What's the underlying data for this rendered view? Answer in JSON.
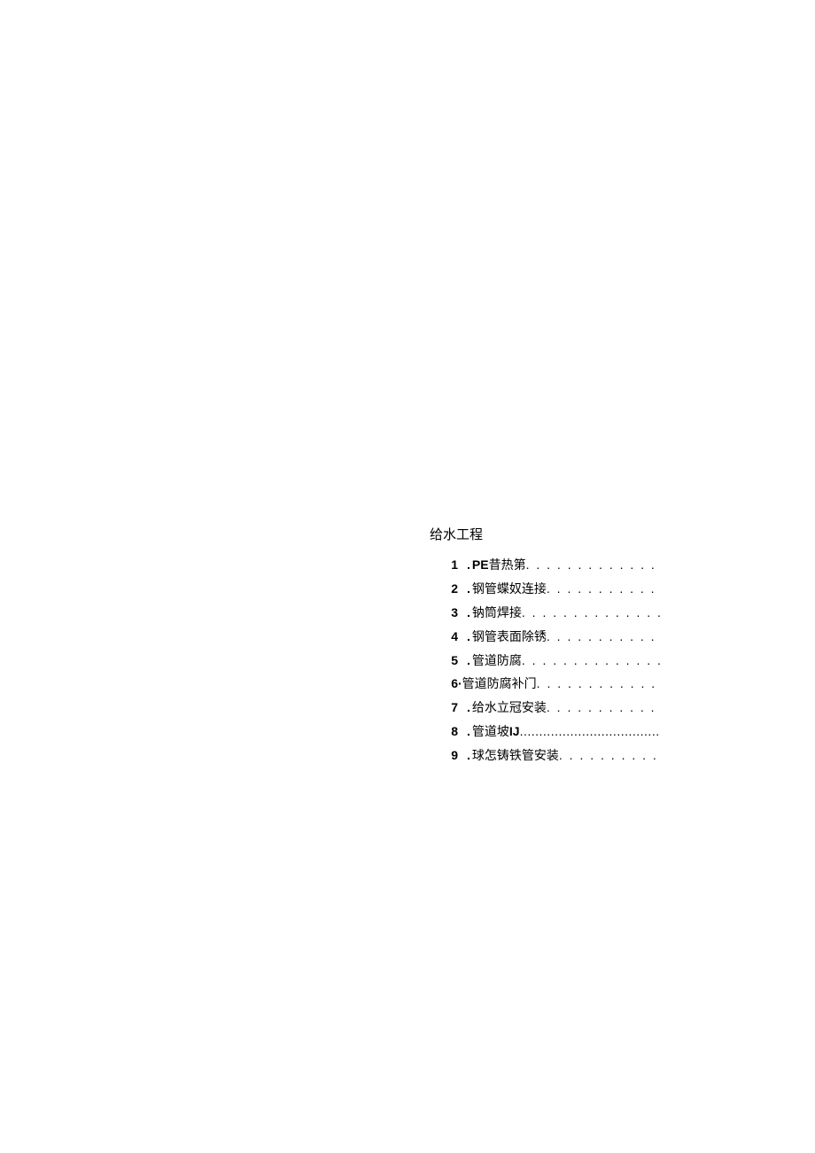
{
  "section": {
    "title": "给水工程"
  },
  "toc": {
    "items": [
      {
        "num": "1",
        "sep": ".",
        "prefix": "PE",
        "text": "昔热第",
        "dots": ". . . . . . . . . . . . . . . . . . . ."
      },
      {
        "num": "2",
        "sep": ".",
        "prefix": "",
        "text": "钢管蝶奴连接",
        "dots": ". . . . . . . . . . . . . . . ."
      },
      {
        "num": "3",
        "sep": ".",
        "prefix": "",
        "text": " 钠筒焊接 ",
        "dots": ". . . . . . . . . . . . . . . . . . . ."
      },
      {
        "num": "4",
        "sep": ".",
        "prefix": "",
        "text": " 钢管表面除锈 ",
        "dots": ". . . . . . . . . . . . . . ."
      },
      {
        "num": "5",
        "sep": ".",
        "prefix": "",
        "text": " 管道防腐 ",
        "dots": ". . . . . . . . . . . . . . . . . . . ."
      },
      {
        "num": "6",
        "sep": "·",
        "prefix": "",
        "text": "管道防腐补门 ",
        "dots": ". . . . . . . . . . . . . . . . ."
      },
      {
        "num": "7",
        "sep": ".",
        "prefix": "",
        "text": "给水立冠安装 ",
        "dots": ". . . . . . . . . . . . . . ."
      },
      {
        "num": "8",
        "sep": ".",
        "prefix": "",
        "text": "管道坡",
        "suffix": "IJ ",
        "dots": "......................................"
      },
      {
        "num": "9",
        "sep": ".",
        "prefix": "",
        "text": " 球怎铸铁管安装 ",
        "dots": ". . . . . . . . . . . . ."
      }
    ]
  }
}
